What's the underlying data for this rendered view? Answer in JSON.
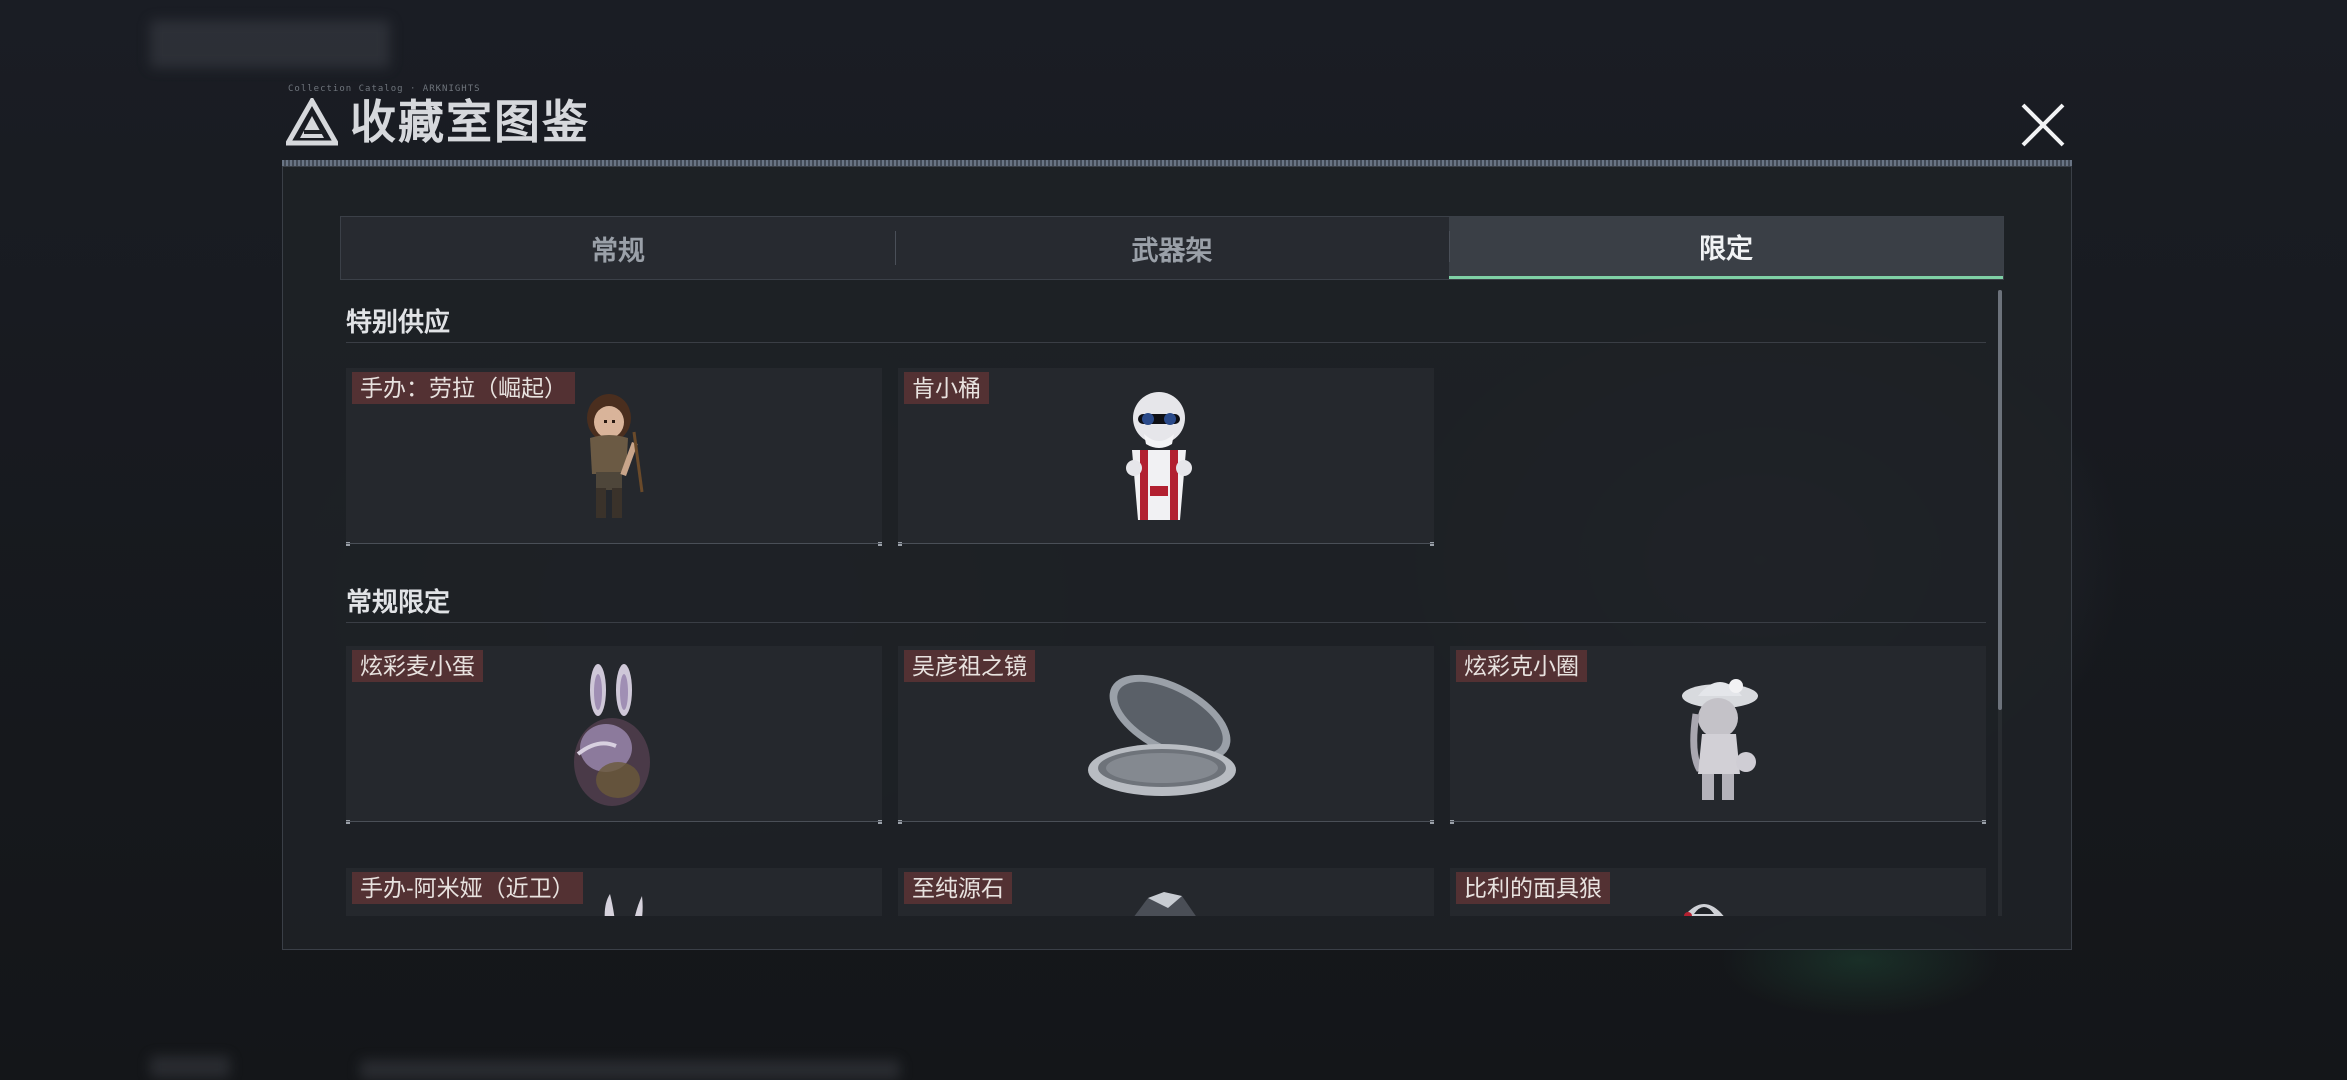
{
  "dialog": {
    "title": "收藏室图鉴",
    "title_tiny_text": "Collection Catalog · ARKNIGHTS",
    "close_label": "close"
  },
  "tabs": [
    {
      "label": "常规",
      "active": false
    },
    {
      "label": "武器架",
      "active": false
    },
    {
      "label": "限定",
      "active": true
    }
  ],
  "sections": [
    {
      "title": "特别供应",
      "items": [
        {
          "label": "手办：劳拉（崛起）",
          "icon": "figurine-lara-icon"
        },
        {
          "label": "肯小桶",
          "icon": "figurine-kfc-bucket-icon"
        }
      ]
    },
    {
      "title": "常规限定",
      "items": [
        {
          "label": "炫彩麦小蛋",
          "icon": "egg-bunny-icon"
        },
        {
          "label": "吴彦祖之镜",
          "icon": "compact-mirror-icon"
        },
        {
          "label": "炫彩克小圈",
          "icon": "figurine-girl-hat-icon"
        },
        {
          "label": "手办-阿米娅（近卫）",
          "icon": "figurine-amiya-icon"
        },
        {
          "label": "至纯源石",
          "icon": "originium-stone-icon"
        },
        {
          "label": "比利的面具狼",
          "icon": "wolf-mask-icon"
        }
      ]
    }
  ],
  "colors": {
    "accent": "#7fd1a6",
    "label_bg": "#7a3838",
    "panel": "#1e2126"
  }
}
